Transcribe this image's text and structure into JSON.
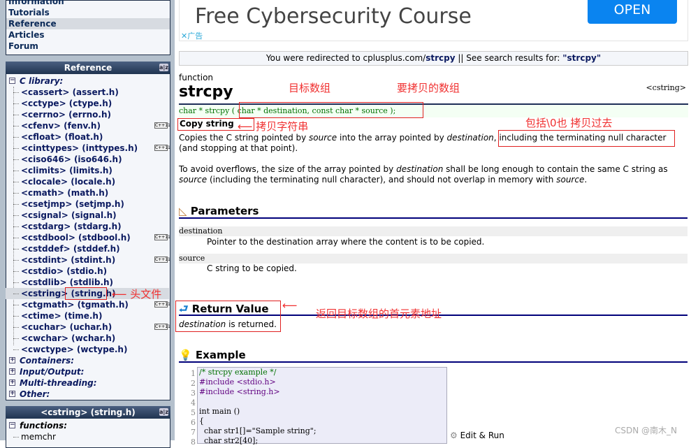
{
  "sidebar": {
    "nav": [
      "Information",
      "Tutorials",
      "Reference",
      "Articles",
      "Forum"
    ],
    "reference_header": "Reference",
    "c_library_label": "C library:",
    "headers": [
      {
        "label": "<cassert> (assert.h)",
        "cpp11": false
      },
      {
        "label": "<cctype> (ctype.h)",
        "cpp11": false
      },
      {
        "label": "<cerrno> (errno.h)",
        "cpp11": false
      },
      {
        "label": "<cfenv> (fenv.h)",
        "cpp11": true
      },
      {
        "label": "<cfloat> (float.h)",
        "cpp11": false
      },
      {
        "label": "<cinttypes> (inttypes.h)",
        "cpp11": true
      },
      {
        "label": "<ciso646> (iso646.h)",
        "cpp11": false
      },
      {
        "label": "<climits> (limits.h)",
        "cpp11": false
      },
      {
        "label": "<clocale> (locale.h)",
        "cpp11": false
      },
      {
        "label": "<cmath> (math.h)",
        "cpp11": false
      },
      {
        "label": "<csetjmp> (setjmp.h)",
        "cpp11": false
      },
      {
        "label": "<csignal> (signal.h)",
        "cpp11": false
      },
      {
        "label": "<cstdarg> (stdarg.h)",
        "cpp11": false
      },
      {
        "label": "<cstdbool> (stdbool.h)",
        "cpp11": true
      },
      {
        "label": "<cstddef> (stddef.h)",
        "cpp11": false
      },
      {
        "label": "<cstdint> (stdint.h)",
        "cpp11": true
      },
      {
        "label": "<cstdio> (stdio.h)",
        "cpp11": false
      },
      {
        "label": "<cstdlib> (stdlib.h)",
        "cpp11": false
      },
      {
        "label": "<cstring>",
        "label2": "(string.h)",
        "cpp11": false,
        "selected": true
      },
      {
        "label": "<ctgmath> (tgmath.h)",
        "cpp11": true
      },
      {
        "label": "<ctime> (time.h)",
        "cpp11": false
      },
      {
        "label": "<cuchar> (uchar.h)",
        "cpp11": true
      },
      {
        "label": "<cwchar> (wchar.h)",
        "cpp11": false
      },
      {
        "label": "<cwctype> (wctype.h)",
        "cpp11": false
      }
    ],
    "groups": [
      "Containers:",
      "Input/Output:",
      "Multi-threading:",
      "Other:"
    ],
    "cpp11_badge": "C++11",
    "az_icon": "a|z",
    "cstring_header": "<cstring> (string.h)",
    "functions_label": "functions:",
    "functions": [
      "memchr"
    ]
  },
  "ad": {
    "title": "Free Cybersecurity Course",
    "button": "OPEN",
    "label": "广告",
    "close": "✕"
  },
  "redirect": {
    "prefix": "You were redirected to cplusplus.com/",
    "term": "strcpy",
    "mid": " || See search results for: ",
    "quoted": "\"strcpy\""
  },
  "doc": {
    "kind": "function",
    "name": "strcpy",
    "header": "<cstring>",
    "prototype": "char * strcpy ( char * destination, const char * source );",
    "summary": "Copy string",
    "p1a": "Copies the C string pointed by ",
    "p1b": "source",
    "p1c": " into the array pointed by ",
    "p1d": "destination",
    "p1e": ",",
    "p1f": "including the terminating null character",
    "p1g": "(and stopping at that point).",
    "p2a": "To avoid overflows, the size of the array pointed by ",
    "p2b": "destination",
    "p2c": " shall be long enough to contain the same C string as ",
    "p2d": "source",
    "p2e": " (including the terminating null character), and should not overlap in memory with ",
    "p2f": "source",
    "p2g": ".",
    "params_title": "Parameters",
    "params": [
      {
        "name": "destination",
        "desc": "Pointer to the destination array where the content is to be copied."
      },
      {
        "name": "source",
        "desc": "C string to be copied."
      }
    ],
    "return_title": "Return Value",
    "return_a": "destination",
    "return_b": " is returned.",
    "example_title": "Example",
    "code": [
      "/* strcpy example */",
      "#include <stdio.h>",
      "#include <string.h>",
      "",
      "int main ()",
      "{",
      "  char str1[]=\"Sample string\";",
      "  char str2[40];"
    ],
    "edit_run": "Edit & Run"
  },
  "annotations": {
    "dest": "目标数组",
    "src": "要拷贝的数组",
    "copy": "拷贝字符串",
    "null": "包括\\0也 拷贝过去",
    "header": "头文件",
    "ret": "返回目标数组的首元素地址"
  },
  "watermark": "CSDN @南木_N",
  "colors": {
    "annotation": "#f03030",
    "sidebar_header": "#203450",
    "open_button": "#0a84f0",
    "code_green": "#007000"
  }
}
